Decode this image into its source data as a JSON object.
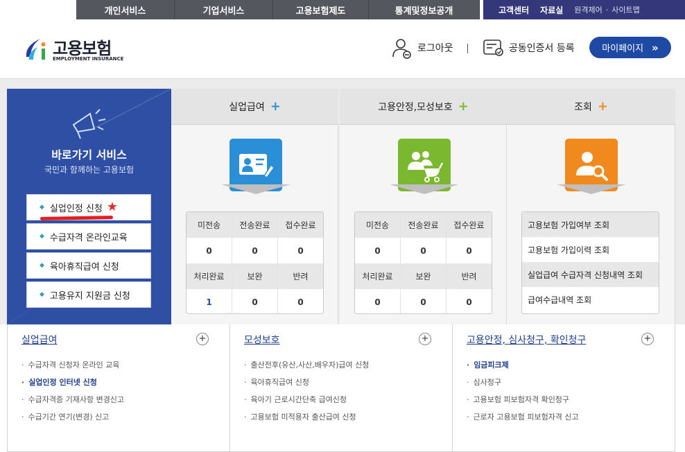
{
  "topnav": {
    "menu": [
      "개인서비스",
      "기업서비스",
      "고용보험제도",
      "통계및정보공개"
    ],
    "util": {
      "center": "고객센터",
      "library": "자료실",
      "remote": "원격제어",
      "dot": "·",
      "sitemap": "사이트맵"
    }
  },
  "header": {
    "logo_text": "고용보험",
    "logo_sub": "EMPLOYMENT INSURANCE",
    "logout": "로그아웃",
    "cert": "공동인증서 등록",
    "mypage": "마이페이지",
    "mypage_chevron": "»"
  },
  "quick": {
    "title": "바로가기 서비스",
    "subtitle": "국민과 함께하는 고용보험",
    "items": [
      "실업인정 신청",
      "수급자격 온라인교육",
      "육아휴직급여 신청",
      "고용유지 지원금 신청"
    ]
  },
  "columns": {
    "unemp": {
      "title": "실업급여",
      "plus": "+",
      "head1": [
        "미전송",
        "전송완료",
        "접수완료"
      ],
      "val1": [
        "0",
        "0",
        "0"
      ],
      "head2": [
        "처리완료",
        "보완",
        "반려"
      ],
      "val2": [
        "1",
        "0",
        "0"
      ]
    },
    "stab": {
      "title": "고용안정,모성보호",
      "plus": "+",
      "head1": [
        "미전송",
        "전송완료",
        "접수완료"
      ],
      "val1": [
        "0",
        "0",
        "0"
      ],
      "head2": [
        "처리완료",
        "보완",
        "반려"
      ],
      "val2": [
        "0",
        "0",
        "0"
      ]
    },
    "lookup": {
      "title": "조회",
      "plus": "+",
      "items": [
        "고용보험 가입여부 조회",
        "고용보험 가입이력 조회",
        "실업급여 수급자격 신청내역 조회",
        "급여수급내역 조회"
      ]
    }
  },
  "bottom": [
    {
      "title": "실업급여",
      "plus": "+",
      "items": [
        "수급자격 신청자 온라인 교육",
        "실업인정 인터넷 신청",
        "수급자격증 기재사항 변경신고",
        "수급기간 연기(변경) 신고"
      ]
    },
    {
      "title": "모성보호",
      "plus": "+",
      "items": [
        "출산전후(유산,사산,배우자)급여 신청",
        "육아휴직급여 신청",
        "육아기 근로시간단축 급여신청",
        "고용보험 미적용자 출산급여 신청"
      ]
    },
    {
      "title": "고용안정, 심사청구, 확인청구",
      "plus": "+",
      "items": [
        "임금피크제",
        "심사청구",
        "고용보험 피보험자격 확인청구",
        "근로자 고용보험 피보험자격 신고"
      ]
    }
  ],
  "colors": {
    "nav": "#54575e",
    "util": "#34387a",
    "brand_blue": "#1f4aa3",
    "quick_bg": "#2f4fa5",
    "icon_blue": "#2b8fd8",
    "icon_green": "#7cb82f",
    "icon_orange": "#f08a1f"
  }
}
